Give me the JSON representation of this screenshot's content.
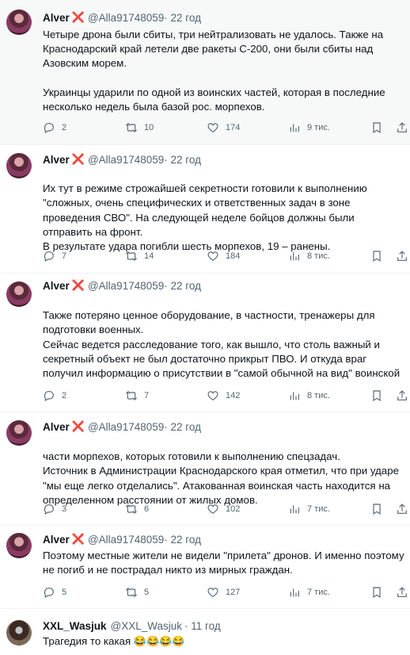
{
  "tweets": [
    {
      "name": "Alver",
      "badge": "❌",
      "handle": "@Alla91748059",
      "time": "· 22 год",
      "paragraphs": [
        "Четыре дрона были сбиты, три нейтрализовать не удалось. Также на Краснодарский край летели две ракеты С-200, они были сбиты над Азовским морем.",
        "Украинцы ударили по одной из воинских частей, которая в последние несколько недель была базой рос. морпехов."
      ],
      "replies": "2",
      "retweets": "10",
      "likes": "174",
      "views": "9 тис."
    },
    {
      "name": "Alver",
      "badge": "❌",
      "handle": "@Alla91748059",
      "time": "· 22 год",
      "paragraphs": [
        "Их тут в режиме строжайшей секретности готовили к выполнению \"сложных, очень специфических и ответственных задач в зоне проведения СВО\". На следующей неделе бойцов должны были отправить на фронт.\nВ результате удара погибли шесть морпехов, 19 – ранены."
      ],
      "replies": "7",
      "retweets": "14",
      "likes": "184",
      "views": "8 тис."
    },
    {
      "name": "Alver",
      "badge": "❌",
      "handle": "@Alla91748059",
      "time": "· 22 год",
      "paragraphs": [
        "Также потеряно ценное оборудование, в частности, тренажеры для подготовки военных.\nСейчас ведется расследование того, как вышло, что столь важный и секретный объект не был достаточно прикрыт ПВО. И откуда враг получил информацию о присутствии в \"самой обычной на вид\" воинской"
      ],
      "replies": "2",
      "retweets": "7",
      "likes": "142",
      "views": "8 тис."
    },
    {
      "name": "Alver",
      "badge": "❌",
      "handle": "@Alla91748059",
      "time": "· 22 год",
      "paragraphs": [
        "части морпехов, которых готовили к выполнению спецзадач.\nИсточник в Администрации Краснодарского края отметил, что при ударе \"мы еще легко отделались\". Атакованная воинская часть находится на определенном расстоянии от жилых домов."
      ],
      "replies": "3",
      "retweets": "6",
      "likes": "102",
      "views": "7 тис."
    },
    {
      "name": "Alver",
      "badge": "❌",
      "handle": "@Alla91748059",
      "time": "· 22 год",
      "paragraphs": [
        "Поэтому местные жители не видели \"прилета\" дронов. И именно поэтому не погиб и не пострадал никто из мирных граждан."
      ],
      "replies": "5",
      "retweets": "5",
      "likes": "127",
      "views": "7 тис."
    }
  ],
  "reply": {
    "name": "XXL_Wasjuk",
    "handle": "@XXL_Wasjuk",
    "time": "· 11 год",
    "text": "Трагедия то какая",
    "emojis": "😂😂😂😂"
  },
  "icons": {
    "reply": "speech-bubble-icon",
    "retweet": "retweet-icon",
    "like": "heart-icon",
    "views": "bar-chart-icon",
    "bookmark": "bookmark-icon",
    "share": "share-icon"
  }
}
